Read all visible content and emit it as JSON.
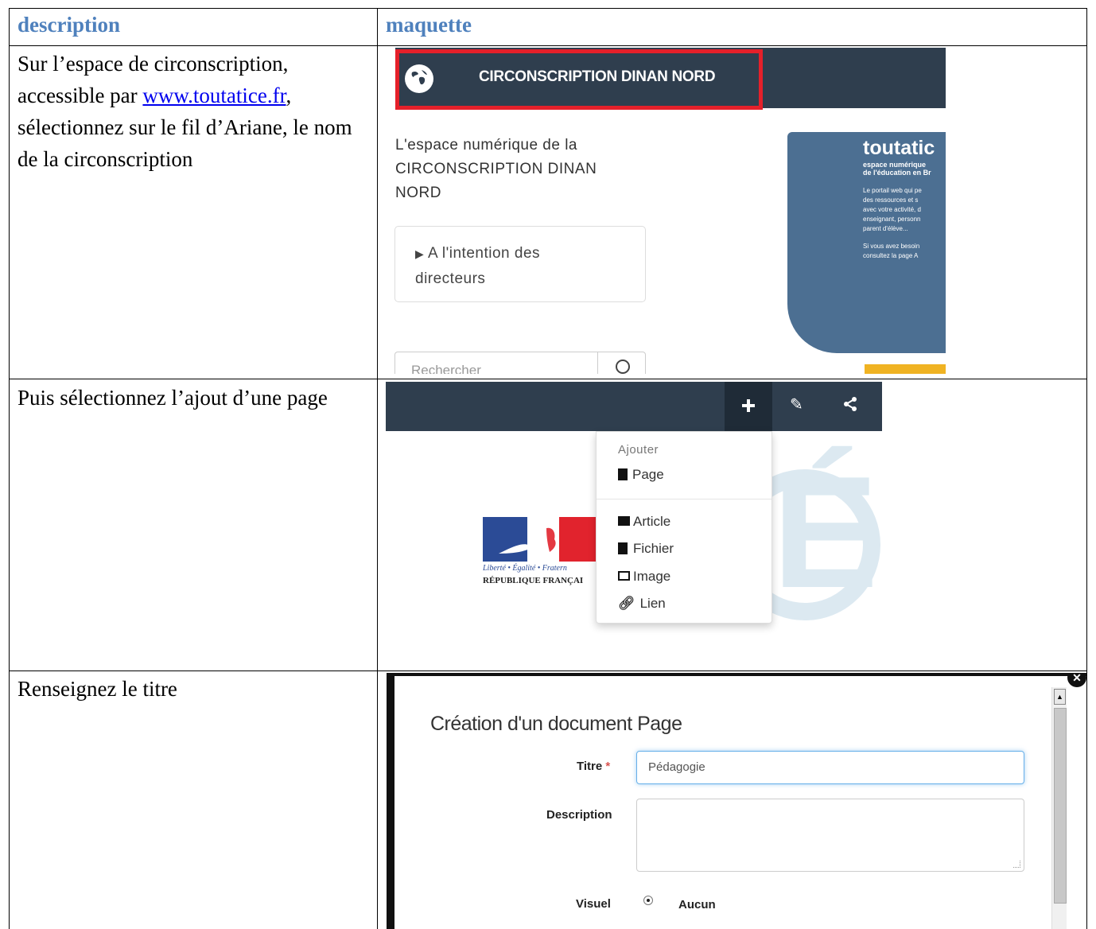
{
  "table": {
    "headers": {
      "description": "description",
      "maquette": "maquette"
    },
    "rows": [
      {
        "description": {
          "before": "Sur l’espace de circonscription, accessible par ",
          "link": "www.toutatice.fr",
          "after": ", sélectionnez sur le fil d’Ariane, le nom de la circonscription"
        }
      },
      {
        "description": "Puis sélectionnez l’ajout d’une page"
      },
      {
        "description": "Renseignez le titre"
      }
    ]
  },
  "shot1": {
    "banner_title": "CIRCONSCRIPTION DINAN NORD",
    "intro_line1": "L'espace numérique de la",
    "intro_line2": "CIRCONSCRIPTION DINAN",
    "intro_line3": "NORD",
    "box_line1": "A l'intention des",
    "box_line2": "directeurs",
    "search_placeholder": "Rechercher",
    "promo_title": "toutatic",
    "promo_sub1": "espace numérique",
    "promo_sub2": "de l'éducation en Br",
    "promo_lines": [
      "Le portail web qui pe",
      "des ressources et s",
      "avec votre activité, d",
      "enseignant, personn",
      "parent d'élève...",
      "",
      "Si vous avez besoin",
      "consultez la page A"
    ]
  },
  "shot2": {
    "menu_header": "Ajouter",
    "items": [
      "Page",
      "Article",
      "Fichier",
      "Image",
      "Lien"
    ],
    "logo_motto": "Liberté • Égalité • Fratern",
    "logo_name": "RÉPUBLIQUE FRANÇAI"
  },
  "shot3": {
    "dialog_title": "Création d'un document Page",
    "titre_label": "Titre",
    "required_mark": "*",
    "titre_value": "Pédagogie",
    "description_label": "Description",
    "visuel_label": "Visuel",
    "visuel_option": "Aucun"
  },
  "colors": {
    "header_text": "#4f81bd",
    "nav_dark": "#2f3e4e",
    "highlight": "#e5202a",
    "promo_blue": "#4c6f92"
  }
}
